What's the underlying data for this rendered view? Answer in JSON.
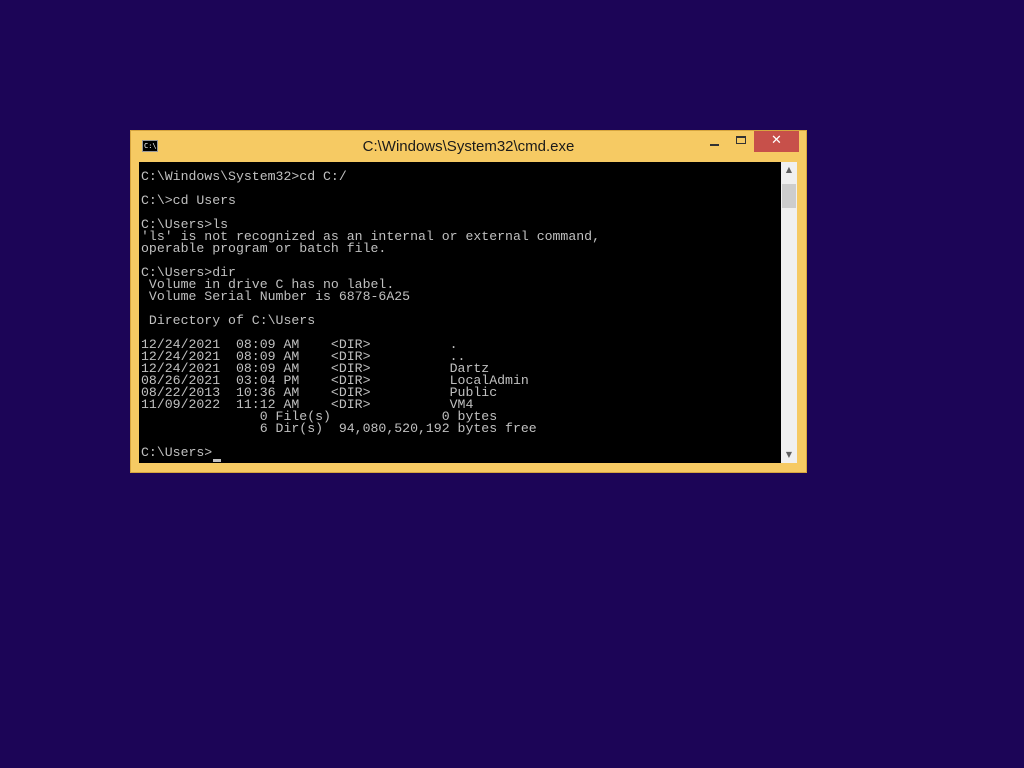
{
  "window": {
    "title": "C:\\Windows\\System32\\cmd.exe",
    "icon": "cmd-icon",
    "icon_text": "C:\\",
    "controls": {
      "minimize": "minimize-icon",
      "maximize": "maximize-icon",
      "close": "close-icon",
      "close_glyph": "✕"
    },
    "colors": {
      "frame": "#f6ca63",
      "close_button": "#c7504a",
      "desktop": "#1c0557",
      "console_background": "#000000",
      "console_text": "#c0c0c0"
    }
  },
  "console": {
    "lines": [
      "C:\\Windows\\System32>cd C:/",
      "",
      "C:\\>cd Users",
      "",
      "C:\\Users>ls",
      "'ls' is not recognized as an internal or external command,",
      "operable program or batch file.",
      "",
      "C:\\Users>dir",
      " Volume in drive C has no label.",
      " Volume Serial Number is 6878-6A25",
      "",
      " Directory of C:\\Users",
      "",
      "12/24/2021  08:09 AM    <DIR>          .",
      "12/24/2021  08:09 AM    <DIR>          ..",
      "12/24/2021  08:09 AM    <DIR>          Dartz",
      "08/26/2021  03:04 PM    <DIR>          LocalAdmin",
      "08/22/2013  10:36 AM    <DIR>          Public",
      "11/09/2022  11:12 AM    <DIR>          VM4",
      "               0 File(s)              0 bytes",
      "               6 Dir(s)  94,080,520,192 bytes free",
      "",
      "C:\\Users>"
    ]
  },
  "scrollbar": {
    "up_arrow": "▲",
    "down_arrow": "▼"
  }
}
